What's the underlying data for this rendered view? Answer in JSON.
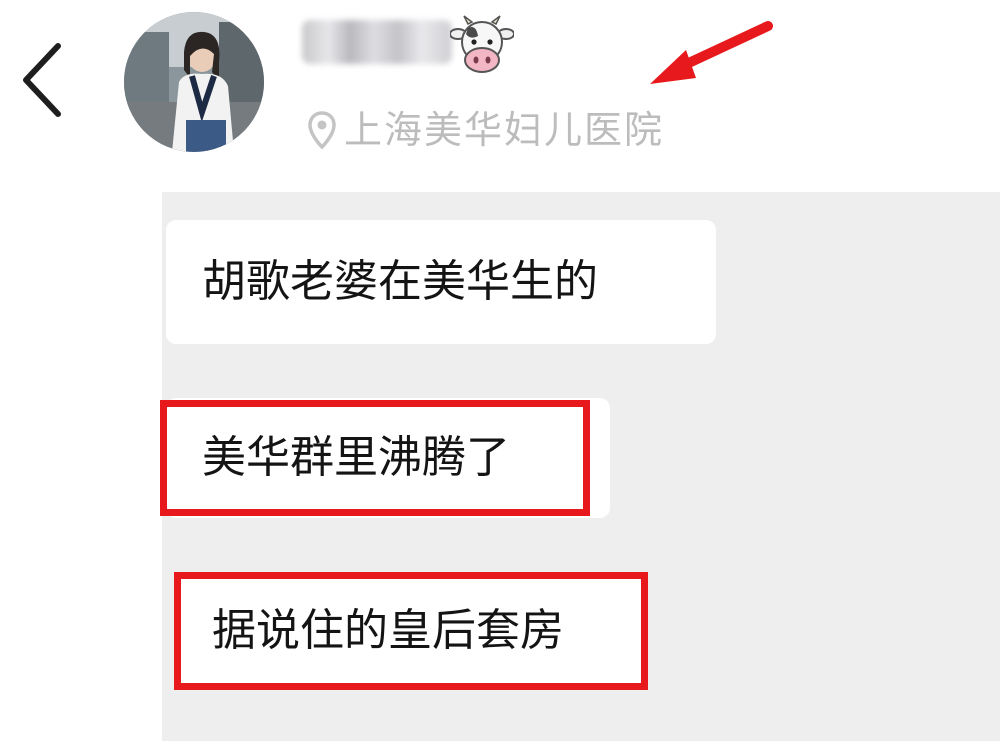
{
  "header": {
    "location_text": "上海美华妇儿医院",
    "icons": {
      "back": "chevron-left-icon",
      "location": "location-pin-icon",
      "emoji": "cow-face-icon"
    }
  },
  "messages": [
    {
      "text": "胡歌老婆在美华生的",
      "highlighted": false
    },
    {
      "text": "美华群里沸腾了",
      "highlighted": true
    },
    {
      "text": "据说住的皇后套房",
      "highlighted": true
    }
  ],
  "colors": {
    "highlight": "#e8191c",
    "arrow": "#e8191c",
    "chat_background": "#eeeeee",
    "location_text": "#bcbcbc"
  }
}
